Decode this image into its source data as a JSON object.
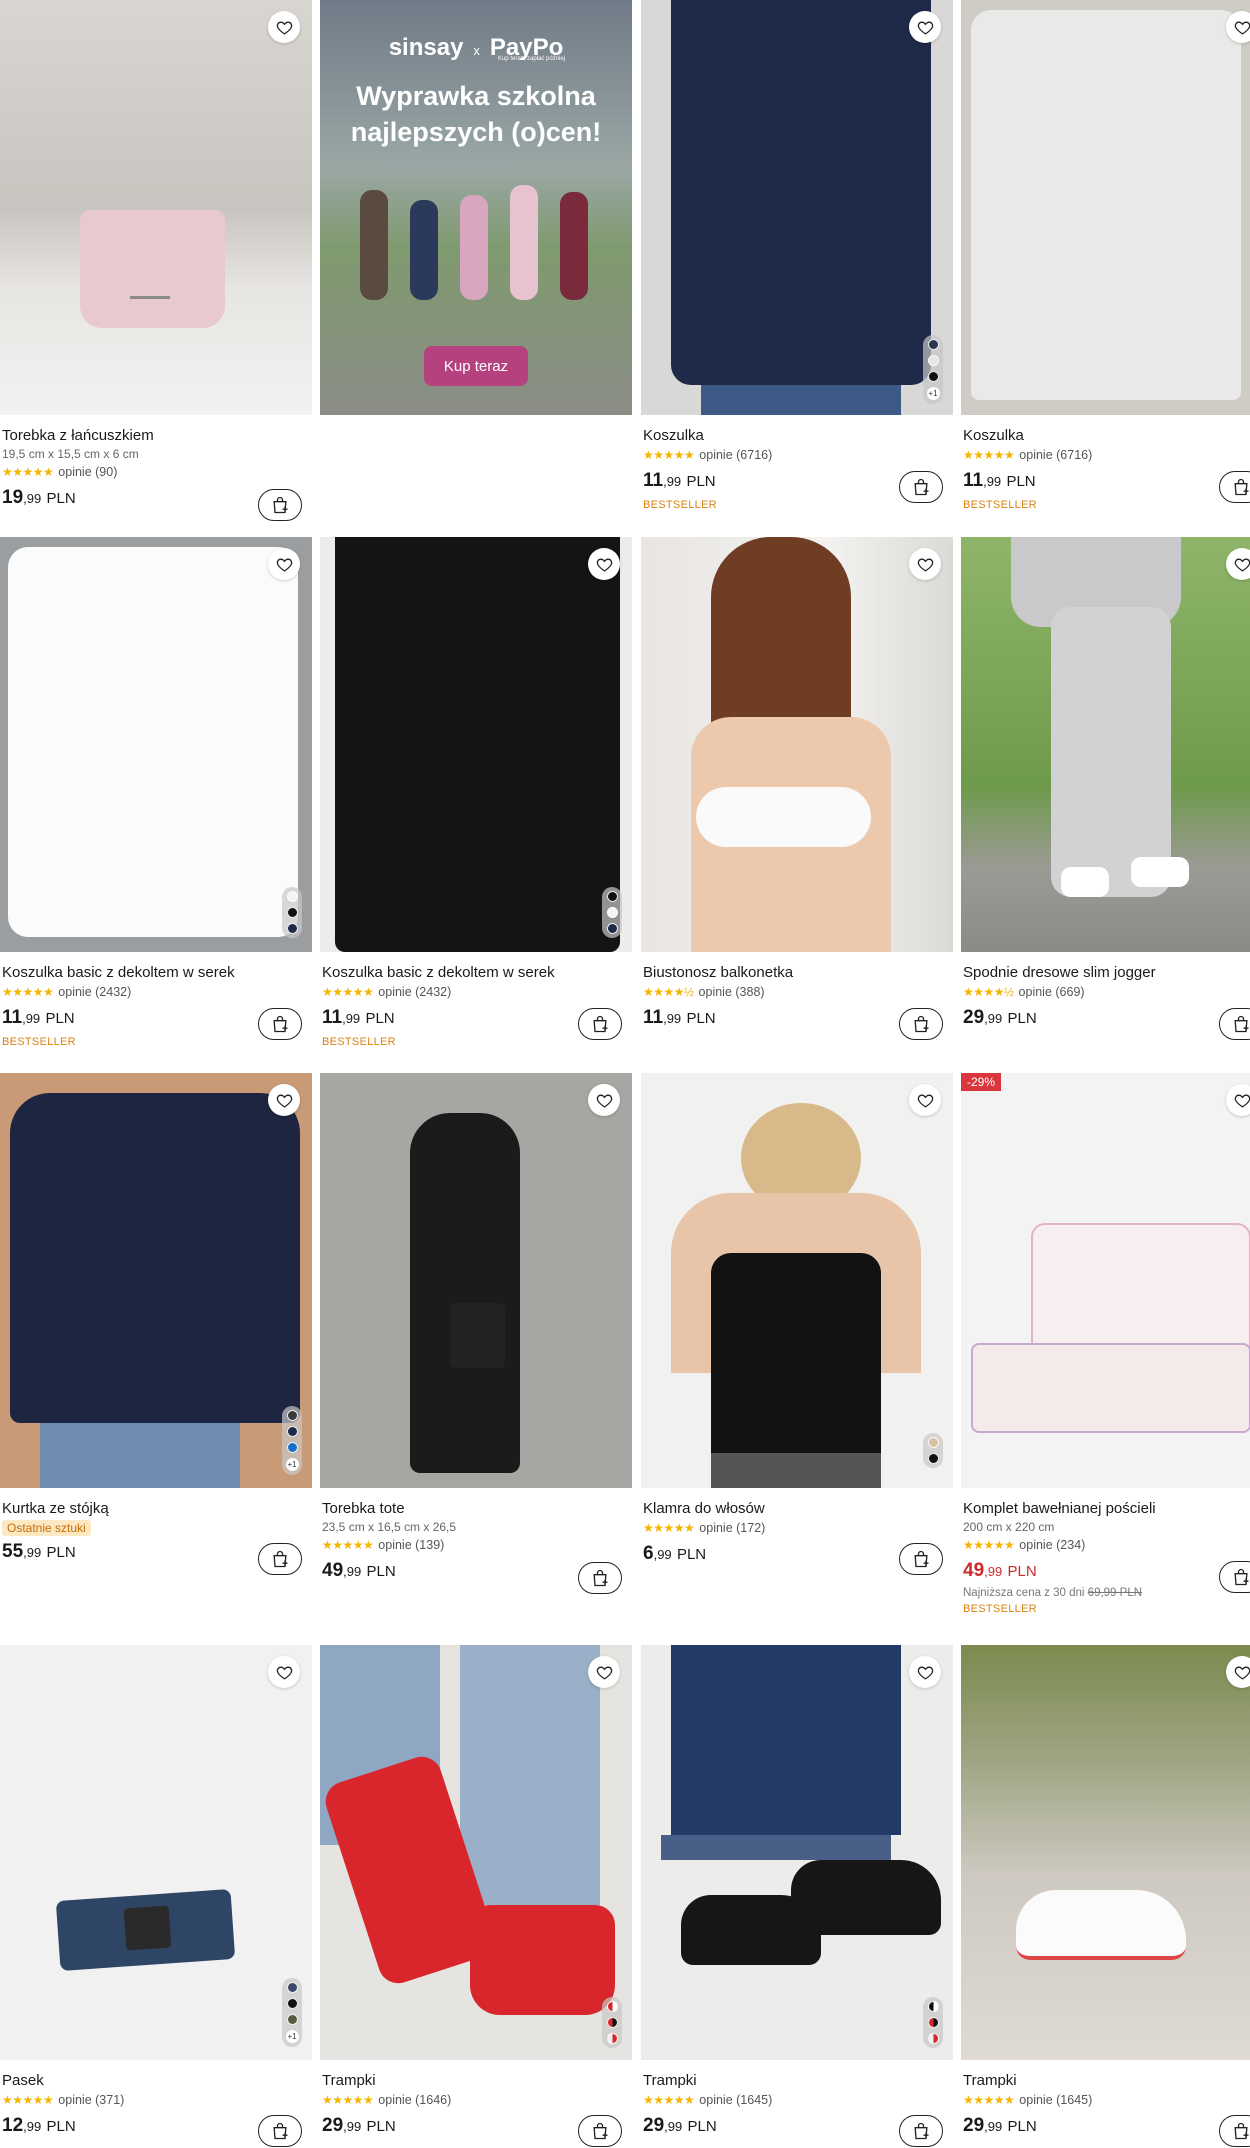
{
  "colors": {
    "stars": "#f5b400",
    "bestseller": "#d9820e",
    "sale_price": "#cc2a2a",
    "badge": "#d9363e",
    "cta": "#b5417f"
  },
  "banner": {
    "brand": "sinsay",
    "x": "x",
    "partner": "PayPo",
    "partner_tagline": "Kup teraz, zapłać później",
    "headline_1": "Wyprawka szkolna",
    "headline_2": "najlepszych (o)cen!",
    "cta": "Kup teraz"
  },
  "products": [
    {
      "title": "Torebka z łańcuszkiem",
      "dims": "19,5 cm x 15,5 cm x 6 cm",
      "stars": "★★★★★",
      "reviews": "opinie (90)",
      "price_int": "19",
      "price_dec": ",99",
      "currency": "PLN"
    },
    {
      "title": "Koszulka",
      "stars": "★★★★★",
      "reviews": "opinie (6716)",
      "price_int": "11",
      "price_dec": ",99",
      "currency": "PLN",
      "bestseller": "BESTSELLER"
    },
    {
      "title": "Koszulka",
      "stars": "★★★★★",
      "reviews": "opinie (6716)",
      "price_int": "11",
      "price_dec": ",99",
      "currency": "PLN",
      "bestseller": "BESTSELLER"
    },
    {
      "title": "Koszulka basic z dekoltem w serek",
      "stars": "★★★★★",
      "reviews": "opinie (2432)",
      "price_int": "11",
      "price_dec": ",99",
      "currency": "PLN",
      "bestseller": "BESTSELLER"
    },
    {
      "title": "Koszulka basic z dekoltem w serek",
      "stars": "★★★★★",
      "reviews": "opinie (2432)",
      "price_int": "11",
      "price_dec": ",99",
      "currency": "PLN",
      "bestseller": "BESTSELLER"
    },
    {
      "title": "Biustonosz balkonetka",
      "stars": "★★★★½",
      "reviews": "opinie (388)",
      "price_int": "11",
      "price_dec": ",99",
      "currency": "PLN"
    },
    {
      "title": "Spodnie dresowe slim jogger",
      "stars": "★★★★½",
      "reviews": "opinie (669)",
      "price_int": "29",
      "price_dec": ",99",
      "currency": "PLN"
    },
    {
      "title": "Kurtka ze stójką",
      "last_pieces": "Ostatnie sztuki",
      "price_int": "55",
      "price_dec": ",99",
      "currency": "PLN"
    },
    {
      "title": "Torebka tote",
      "dims": "23,5 cm x 16,5 cm x 26,5",
      "stars": "★★★★★",
      "reviews": "opinie (139)",
      "price_int": "49",
      "price_dec": ",99",
      "currency": "PLN"
    },
    {
      "title": "Klamra do włosów",
      "stars": "★★★★★",
      "reviews": "opinie (172)",
      "price_int": "6",
      "price_dec": ",99",
      "currency": "PLN"
    },
    {
      "title": "Komplet bawełnianej pościeli",
      "dims": "200 cm x 220 cm",
      "stars": "★★★★★",
      "reviews": "opinie (234)",
      "price_int": "49",
      "price_dec": ",99",
      "currency": "PLN",
      "badge": "-29%",
      "lowest_label": "Najniższa cena z 30 dni",
      "lowest_price": "69,99 PLN",
      "bestseller": "BESTSELLER"
    },
    {
      "title": "Pasek",
      "stars": "★★★★★",
      "reviews": "opinie (371)",
      "price_int": "12",
      "price_dec": ",99",
      "currency": "PLN"
    },
    {
      "title": "Trampki",
      "stars": "★★★★★",
      "reviews": "opinie (1646)",
      "price_int": "29",
      "price_dec": ",99",
      "currency": "PLN"
    },
    {
      "title": "Trampki",
      "stars": "★★★★★",
      "reviews": "opinie (1645)",
      "price_int": "29",
      "price_dec": ",99",
      "currency": "PLN"
    },
    {
      "title": "Trampki",
      "stars": "★★★★★",
      "reviews": "opinie (1645)",
      "price_int": "29",
      "price_dec": ",99",
      "currency": "PLN"
    }
  ],
  "swatch_more": "+1"
}
